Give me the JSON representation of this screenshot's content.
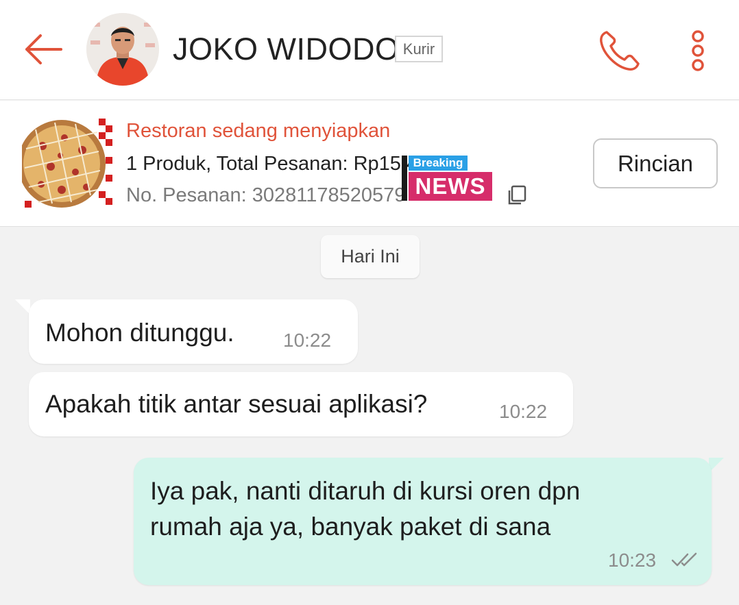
{
  "header": {
    "contact_name": "JOKO WIDODO",
    "role_badge": "Kurir",
    "back_icon": "back-arrow-icon",
    "call_icon": "phone-icon",
    "more_icon": "more-vertical-icon",
    "accent_color": "#e0533a"
  },
  "order": {
    "status": "Restoran sedang menyiapkan",
    "summary": "1 Produk, Total Pesanan: Rp15.495",
    "order_number": "No. Pesanan: 30281178520579",
    "details_button": "Rincian",
    "copy_icon": "copy-icon",
    "overlay": {
      "breaking": "Breaking",
      "news": "NEWS"
    }
  },
  "chat": {
    "date_label": "Hari Ini",
    "messages": [
      {
        "direction": "incoming",
        "text": "Mohon ditunggu.",
        "time": "10:22"
      },
      {
        "direction": "incoming",
        "text": "Apakah titik antar sesuai aplikasi?",
        "time": "10:22"
      },
      {
        "direction": "outgoing",
        "text_line1": "Iya pak, nanti ditaruh di kursi oren dpn",
        "text_line2": "rumah aja ya, banyak paket di sana",
        "time": "10:23",
        "status_icon": "double-check-icon"
      }
    ]
  }
}
